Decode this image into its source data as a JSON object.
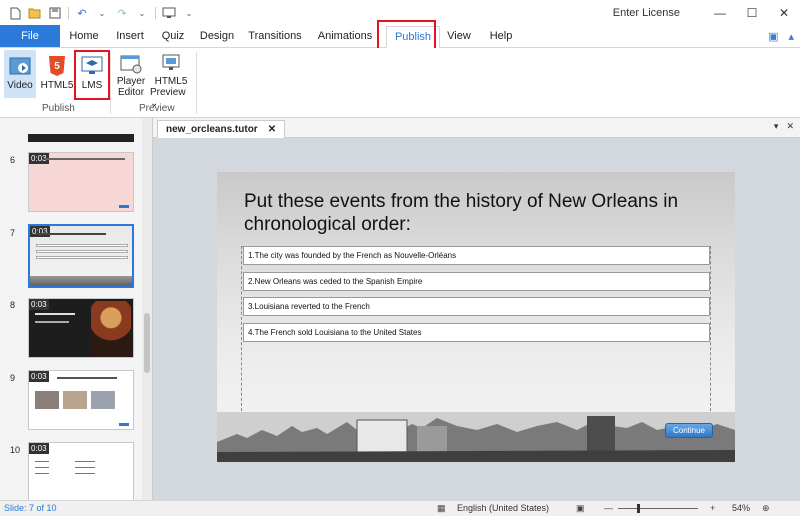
{
  "titlebar": {
    "quick_access": [
      "new-icon",
      "open-icon",
      "save-icon",
      "undo-icon",
      "redo-icon",
      "preview-icon"
    ],
    "license_label": "Enter License",
    "min": "—",
    "max": "☐",
    "close": "✕"
  },
  "ribbon_tabs": [
    "File",
    "Home",
    "Insert",
    "Quiz",
    "Design",
    "Transitions",
    "Animations",
    "Publish",
    "View",
    "Help"
  ],
  "active_tab": "Publish",
  "ribbon": {
    "publish_group": {
      "label": "Publish",
      "buttons": [
        {
          "label": "Video",
          "icon": "video-icon"
        },
        {
          "label": "HTML5",
          "icon": "html5-icon"
        },
        {
          "label": "LMS",
          "icon": "lms-icon"
        }
      ]
    },
    "preview_group": {
      "label": "Preview",
      "buttons": [
        {
          "label1": "Player",
          "label2": "Editor",
          "icon": "player-editor-icon"
        },
        {
          "label1": "HTML5",
          "label2": "Preview ⌄",
          "icon": "html5-preview-icon"
        }
      ]
    }
  },
  "slide_panel": {
    "slides": [
      {
        "number": "6",
        "duration": "0:03"
      },
      {
        "number": "7",
        "duration": "0:03"
      },
      {
        "number": "8",
        "duration": "0:03"
      },
      {
        "number": "9",
        "duration": "0:03"
      },
      {
        "number": "10",
        "duration": "0:03"
      }
    ],
    "selected": "7"
  },
  "document": {
    "tab_name": "new_orcleans.tutor",
    "tab_close": "✕"
  },
  "slide": {
    "title": "Put these events from the history  of New Orleans in chronological order:",
    "events": [
      "1.The city was founded by the French as Nouvelle-Orléans",
      "2.New Orleans was ceded to the Spanish Empire",
      "3.Louisiana reverted to the French",
      "4.The French sold Louisiana to the United States"
    ],
    "continue_label": "Continue"
  },
  "statusbar": {
    "slide_info": "Slide: 7 of 10",
    "language": "English (United States)",
    "zoom_minus": "—",
    "zoom_plus": "+",
    "zoom_level": "54%",
    "zoom_fraction": 0.54
  },
  "colors": {
    "accent": "#2b79d8",
    "highlight": "#e0161e"
  }
}
